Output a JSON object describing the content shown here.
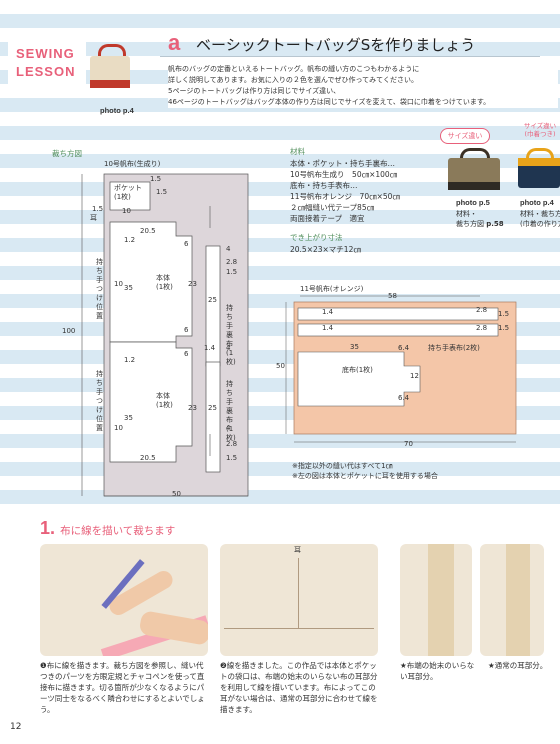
{
  "badge": {
    "line1": "SEWING",
    "line2": "LESSON",
    "photo_ref": "photo p.4"
  },
  "header": {
    "section_letter": "a",
    "title": "ベーシックトートバッグSを作りましょう"
  },
  "intro": [
    "帆布のバッグの定番といえるトートバッグ。帆布の縫い方のこつもわかるように",
    "詳しく説明してあります。お気に入りの２色を選んでぜひ作ってみてください。",
    "5ページのトートバッグは作り方は同じでサイズ違い、",
    "46ページのトートバッグはバッグ本体の作り方は同じでサイズを変えて、袋口に巾着をつけています。"
  ],
  "side_photos": {
    "left": {
      "tag": "サイズ違い",
      "caption_bold": "photo p.5",
      "line1": "材料・",
      "line2_prefix": "裁ち方図",
      "line2_ref": "p.58"
    },
    "right": {
      "tag_line1": "サイズ違い",
      "tag_line2": "(巾着つき)",
      "caption_bold": "photo p.4",
      "line1": "材料・裁ち方図",
      "line2": "(巾着の作り方)"
    }
  },
  "cut_diagram": {
    "title": "裁ち方図",
    "fabric_label": "10号帆布(生成り)",
    "pocket_label": "ポケット\n(1枚)",
    "body_label": "本体\n(1枚)",
    "handle_pos_label": "持ち手つけ位置",
    "handle_lining_label": "持ち手裏布\n(1枚)",
    "width": "50",
    "height": "100",
    "mark": "耳",
    "nums": {
      "n15": "1.5",
      "n10": "10",
      "n205": "20.5",
      "n12": "1.2",
      "n35": "35",
      "n23": "23",
      "n6": "6",
      "n25": "25",
      "n4": "4",
      "n28": "2.8",
      "n14": "1.4"
    }
  },
  "materials": {
    "title": "材料",
    "lines": [
      "本体・ポケット・持ち手裏布…",
      "10号帆布生成り　50㎝×100㎝",
      "底布・持ち手表布…",
      "11号帆布オレンジ　70㎝×50㎝",
      "２㎝幅縫い代テープ85㎝",
      "両面接着テープ　適宜"
    ],
    "size_title": "でき上がり寸法",
    "size": "20.5×23×マチ12㎝"
  },
  "orange_diagram": {
    "fabric_label": "11号帆布(オレンジ)",
    "handle_outer": "持ち手表布(2枚)",
    "bottom_label": "底布(1枚)",
    "n58": "58",
    "n14": "1.4",
    "n28": "2.8",
    "n15": "1.5",
    "n35": "35",
    "n12": "12",
    "n64": "6.4",
    "n50": "50",
    "n70": "70"
  },
  "notes": [
    "※指定以外の縫い代はすべて1㎝",
    "※左の図は本体とポケットに耳を使用する場合"
  ],
  "step": {
    "number": "1.",
    "title": "布に線を描いて裁ちます",
    "photo_mark": "耳",
    "captions": {
      "c1": "❶布に線を描きます。裁ち方図を参照し、縫い代つきのパーツを方眼定規とチャコペンを使って直接布に描きます。切る箇所が少なくなるようにパーツ同士をなるべく隣合わせにするとよいでしょう。",
      "c2": "❷線を描きました。この作品では本体とポケットの袋口は、布端の始末のいらない布の耳部分を利用して線を描いています。布によってこの耳がない場合は、通常の耳部分に合わせて線を描きます。",
      "c3": "★布端の始末のいらない耳部分。",
      "c4": "★通常の耳部分。"
    }
  },
  "page_number": "12",
  "colors": {
    "accent": "#e8607a",
    "stripe": "#d9e9f3",
    "orange_fabric": "#f4c6a8",
    "cut_fabric": "#ddd6da",
    "green_label": "#4f8d5a"
  }
}
